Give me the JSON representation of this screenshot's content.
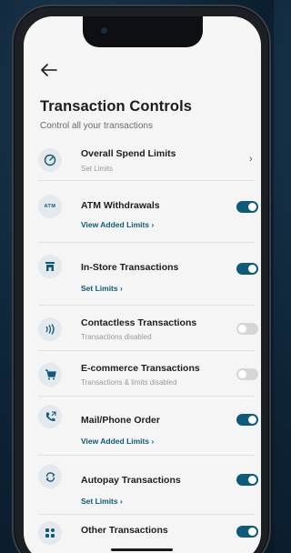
{
  "header": {
    "title": "Transaction Controls",
    "subtitle": "Control all your transactions"
  },
  "items": [
    {
      "title": "Overall Spend Limits",
      "sub": "Set Limits",
      "control": "chevron",
      "icon": "speedometer-icon"
    },
    {
      "title": "ATM Withdrawals",
      "link": "View Added Limits",
      "control": "toggle",
      "toggle_on": true,
      "icon": "atm-icon",
      "icon_text": "ATM"
    },
    {
      "title": "In-Store Transactions",
      "link": "Set Limits",
      "control": "toggle",
      "toggle_on": true,
      "icon": "store-icon"
    },
    {
      "title": "Contactless Transactions",
      "sub": "Transactions disabled",
      "control": "toggle",
      "toggle_on": false,
      "icon": "contactless-icon"
    },
    {
      "title": "E-commerce Transactions",
      "sub": "Transactions & limits disabled",
      "control": "toggle",
      "toggle_on": false,
      "icon": "cart-icon"
    },
    {
      "title": "Mail/Phone Order",
      "link": "View Added Limits",
      "control": "toggle",
      "toggle_on": true,
      "icon": "phone-icon"
    },
    {
      "title": "Autopay Transactions",
      "link": "Set Limits",
      "control": "toggle",
      "toggle_on": true,
      "icon": "autopay-icon"
    },
    {
      "title": "Other Transactions",
      "control": "toggle",
      "toggle_on": true,
      "icon": "grid-icon"
    }
  ],
  "colors": {
    "accent": "#0e5a7a",
    "toggle_off": "#d6d6d6",
    "icon_bg": "#e4e9ee",
    "screen_bg": "#f5f5f5"
  }
}
